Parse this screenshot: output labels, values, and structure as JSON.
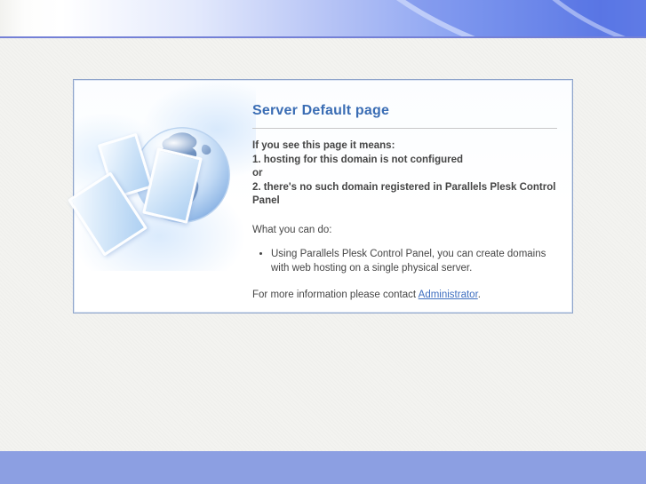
{
  "card": {
    "title": "Server Default page",
    "diagnosis": {
      "lead": "If you see this page it means:",
      "reason1": "1. hosting for this domain is not configured",
      "conjunction": "or",
      "reason2": "2. there's no such domain registered in Parallels Plesk Control Panel"
    },
    "actions_heading": "What you can do:",
    "actions": [
      "Using Parallels Plesk Control Panel, you can create domains with web hosting on a single physical server."
    ],
    "contact": {
      "prefix": "For more information please contact",
      "link_label": "Administrator",
      "suffix": "."
    }
  },
  "illustration": {
    "name": "globe-with-documents"
  },
  "colors": {
    "header_blue": "#5f7ce6",
    "header_border": "#7480d6",
    "footer_blue": "#8c9fe2",
    "title_blue": "#3a6db4",
    "link_blue": "#3f6fc0",
    "body_text": "#4c4c4c",
    "page_bg": "#f3f3f0"
  }
}
